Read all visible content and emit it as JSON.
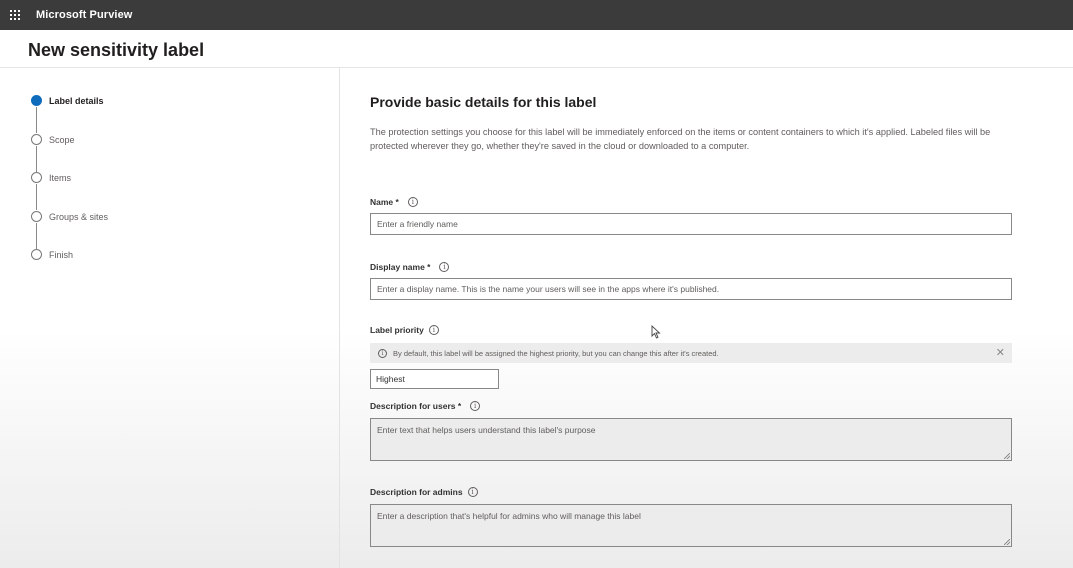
{
  "app": {
    "title": "Microsoft Purview",
    "launcher_icon": "waffle-icon"
  },
  "page": {
    "title": "New sensitivity label"
  },
  "steps": [
    {
      "label": "Label details",
      "state": "active"
    },
    {
      "label": "Scope",
      "state": "pending"
    },
    {
      "label": "Items",
      "state": "pending"
    },
    {
      "label": "Groups & sites",
      "state": "pending"
    },
    {
      "label": "Finish",
      "state": "pending"
    }
  ],
  "form": {
    "title": "Provide basic details for this label",
    "intro": "The protection settings you choose for this label will be immediately enforced on the items or content containers to which it's applied. Labeled files will be protected wherever they go, whether they're saved in the cloud or downloaded to a computer.",
    "name": {
      "label": "Name *",
      "placeholder": "Enter a friendly name"
    },
    "display_name": {
      "label": "Display name *",
      "placeholder": "Enter a display name. This is the name your users will see in the apps where it's published."
    },
    "priority": {
      "label": "Label priority",
      "notice": "By default, this label will be assigned the highest priority, but you can change this after it's created.",
      "value": "Highest"
    },
    "desc_users": {
      "label": "Description for users *",
      "placeholder": "Enter text that helps users understand this label's purpose"
    },
    "desc_admins": {
      "label": "Description for admins",
      "placeholder": "Enter a description that's helpful for admins who will manage this label"
    }
  },
  "colors": {
    "accent": "#0f6cbd",
    "topbar": "#3b3b3b"
  }
}
